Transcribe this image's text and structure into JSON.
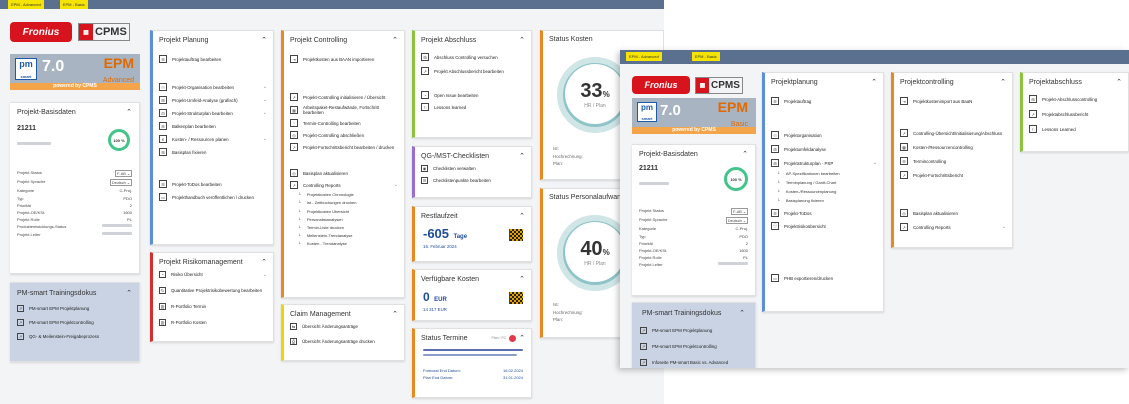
{
  "win1": {
    "tabs": [
      "EPM - Advanced",
      "EPM - Basic"
    ],
    "logo": {
      "brand": "Fronius",
      "cpms": "CPMS",
      "pm": "pm",
      "smart": "smart",
      "version": "7.0",
      "edition": "EPM",
      "edition_sub": "Advanced",
      "powered": "powered by CPMS"
    },
    "basis": {
      "title": "Projekt-Basisdaten",
      "id": "21211",
      "progress": "100 %",
      "rows": [
        [
          "Projekt Status",
          "F-AB"
        ],
        [
          "Projekt Sprache",
          "Deutsch"
        ],
        [
          "Kategorie",
          "C-Proj."
        ],
        [
          "Typ",
          "PDO"
        ],
        [
          "Priorität",
          "2"
        ],
        [
          "Projekt-OE/KSt.",
          "1600"
        ],
        [
          "Projekt Rolle",
          "PL"
        ],
        [
          "Produktentwicklungs-Status",
          ""
        ],
        [
          "Projekt Leiter",
          ""
        ]
      ]
    },
    "training": {
      "title": "PM-smart Trainingsdokus",
      "items": [
        "PM-smart EPM Projektplanung",
        "PM-smart EPM Projektcontrolling",
        "QG- & Meilenstein-Freigabeprozess"
      ]
    },
    "planung": {
      "title": "Projekt Planung",
      "items": [
        "Projektauftrag bearbeiten",
        "Projekt-Organisation bearbeiten",
        "Projekt-Umfeld-Analyse (grafisch)",
        "Projekt-Strukturplan bearbeiten",
        "Balkenplan bearbeiten",
        "Kosten- / Ressourcen planen",
        "Basisplan fixieren",
        "Projekt-ToDos bearbeiten",
        "Projekthandbuch veröffentlichen / drucken"
      ]
    },
    "risiko": {
      "title": "Projekt Risikomanagement",
      "items": [
        "Risiko Übersicht",
        "Quantitative Projektrisikobewertung bearbeiten",
        "R-Portfolio Termin",
        "R-Portfolio Kosten"
      ]
    },
    "controlling": {
      "title": "Projekt Controlling",
      "items": [
        "Projektkosten aus BAAN importieren",
        "Projekt-Controlling initialisieren / Übersicht",
        "Arbeitspaket-Restaufwände, Fortschritt bearbeiten",
        "Termin-Controlling bearbeiten",
        "Projekt-Controlling abschließen",
        "Projekt-Fortschrittsbericht bearbeiten / drucken",
        "Basisplan aktualisieren",
        "Controlling Reports"
      ],
      "reports": [
        "Projektkosten Chronologie",
        "Ist - Zeitbuchungen drucken",
        "Projektkosten Übersicht",
        "Personalistanalysen",
        "Termin-Liste drucken",
        "Meilenstein-Trendanalyse",
        "Kosten - Trendanalyse"
      ]
    },
    "claim": {
      "title": "Claim Management",
      "items": [
        "Übersicht Änderungsanträge",
        "Übersicht Änderungsanträge drucken"
      ]
    },
    "abschluss": {
      "title": "Projekt Abschluss",
      "items": [
        "Abschluss Controlling versuchen",
        "Projekt Abschlussbericht bearbeiten",
        "Open Issue bearbeiten",
        "Lessons learned"
      ]
    },
    "qg": {
      "title": "QG-/MST-Checklisten",
      "items": [
        "Checklisten verwalten",
        "Checklistenpunkte bearbeiten"
      ]
    },
    "rest": {
      "title": "Restlaufzeit",
      "value": "-605",
      "unit": "Tage",
      "date": "16. Februar 2024"
    },
    "verf": {
      "title": "Verfügbare Kosten",
      "value": "0",
      "unit": "EUR",
      "sub": "14 317 EUR"
    },
    "termine": {
      "title": "Status Termine",
      "plan": "Plan / FC",
      "fc_label": "Forecast End Datum:",
      "fc": "16.02.2024",
      "pe_label": "Plan End Datum:",
      "pe": "31.01.2024"
    },
    "skosten": {
      "title": "Status Kosten",
      "pct": "33",
      "unit": "%",
      "sub": "HR / Plan",
      "lines": [
        "Ist:",
        "Hochrechnung:",
        "Plan:"
      ]
    },
    "spers": {
      "title": "Status Personalaufwand",
      "pct": "40",
      "unit": "%",
      "sub": "HR / Plan",
      "lines": [
        "Ist:",
        "Hochrechnung:",
        "Plan:"
      ]
    }
  },
  "win2": {
    "tabs": [
      "EPM - Advanced",
      "EPM - Basic"
    ],
    "logo": {
      "brand": "Fronius",
      "cpms": "CPMS",
      "pm": "pm",
      "smart": "smart",
      "version": "7.0",
      "edition": "EPM",
      "edition_sub": "Basic",
      "powered": "powered by CPMS"
    },
    "basis": {
      "title": "Projekt-Basisdaten",
      "id": "21211",
      "progress": "100 %",
      "rows": [
        [
          "Projekt Status",
          "F-AB"
        ],
        [
          "Projekt Sprache",
          "Deutsch"
        ],
        [
          "Kategorie",
          "C-Proj."
        ],
        [
          "Typ",
          "PDO"
        ],
        [
          "Priorität",
          "2"
        ],
        [
          "Projekt-OE/KSt.",
          "1600"
        ],
        [
          "Projekt Rolle",
          "PL"
        ],
        [
          "Projekt Leiter",
          ""
        ]
      ]
    },
    "training": {
      "title": "PM-smart Trainingsdokus",
      "items": [
        "PM-smart EPM Projektplanung",
        "PM-smart EPM Projektcontrolling",
        "Infoseite PM-smart Basic vs. Advanced"
      ]
    },
    "planung": {
      "title": "Projektplanung",
      "items": [
        "Projektauftrag",
        "Projektorganisation",
        "Projektumfeldanalyse",
        "Projektstrukturplan - PSP",
        "Projekt-ToDos",
        "Projektrisikoübersicht",
        "PHB exportieren/drucken"
      ],
      "psp": [
        "AP-Spezifikationen bearbeiten",
        "Terminplanung / Gantt-Chart",
        "Kosten-/Ressourcenplanung",
        "Basisplanung fixieren"
      ]
    },
    "controlling": {
      "title": "Projektcontrolling",
      "items": [
        "Projektkostenimport aus BaaN",
        "Controlling-Übersicht/Initialisierung/Abschluss",
        "Kosten-/Ressourcencontrolling",
        "Termincontrolling",
        "Projekt-Fortschrittsbericht",
        "Basisplan aktualisieren",
        "Controlling Reports"
      ]
    },
    "abschluss": {
      "title": "Projektabschluss",
      "items": [
        "Projekt-Abschlusscontrolling",
        "Projektabschlussbericht",
        "Lessons Learned"
      ]
    }
  }
}
